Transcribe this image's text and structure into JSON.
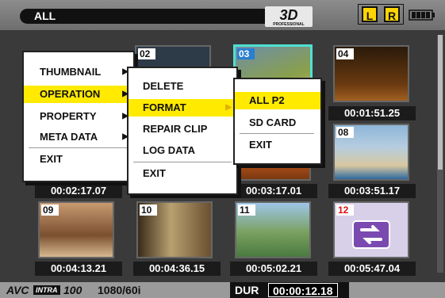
{
  "topbar": {
    "filter_label": "ALL",
    "logo_3d": "3D",
    "logo_sub": "PROFESSIONAL",
    "badge_left": "L",
    "badge_right": "R",
    "battery_icon": "battery-icon"
  },
  "thumbnails": [
    {
      "num": "02",
      "tc": ""
    },
    {
      "num": "03",
      "tc": "00:03:17.01"
    },
    {
      "num": "04",
      "tc": "00:01:51.25"
    },
    {
      "num": "08",
      "tc": "00:03:51.17"
    },
    {
      "num": "09",
      "tc": "00:04:13.21"
    },
    {
      "num": "10",
      "tc": "00:04:36.15"
    },
    {
      "num": "11",
      "tc": "00:05:02.21"
    },
    {
      "num": "12",
      "tc": "00:05:47.04"
    }
  ],
  "first_clip_tc": "00:02:17.07",
  "menu_main": {
    "items": [
      "THUMBNAIL",
      "OPERATION",
      "PROPERTY",
      "META DATA",
      "EXIT"
    ]
  },
  "menu_operation": {
    "items": [
      "DELETE",
      "FORMAT",
      "REPAIR CLIP",
      "LOG DATA",
      "EXIT"
    ]
  },
  "menu_format": {
    "items": [
      "ALL P2",
      "SD CARD",
      "EXIT"
    ]
  },
  "bottombar": {
    "codec_avc": "AVC",
    "codec_intra": "INTRA",
    "codec_bitrate": "100",
    "format": "1080/60i",
    "dur_label": "DUR",
    "dur_value": "00:00:12.18"
  },
  "colors": {
    "highlight": "#ffea00",
    "selection": "#4fe0d0",
    "red_number": "#e01010"
  }
}
